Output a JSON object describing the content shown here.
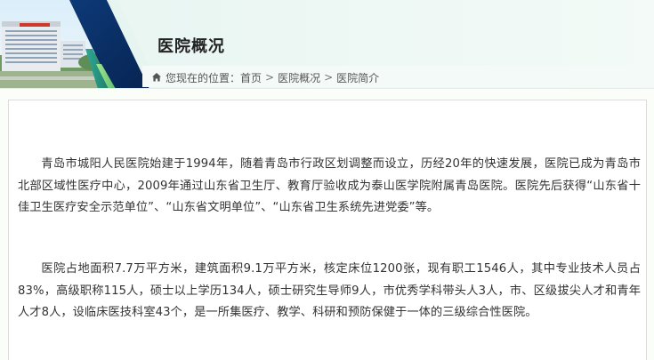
{
  "header": {
    "title": "医院概况"
  },
  "breadcrumb": {
    "prefix": "您现在的位置：",
    "items": [
      "首页",
      "医院概况",
      "医院简介"
    ],
    "separator": ">"
  },
  "icons": {
    "home": "home-icon"
  },
  "colors": {
    "header_bg": "#e2f3f0",
    "accent_dark": "#0b2b63",
    "accent_teal": "#2b8f7c",
    "accent_green": "#7fd17b",
    "text": "#333333"
  },
  "content": {
    "paragraphs": [
      "青岛市城阳人民医院始建于1994年，随着青岛市行政区划调整而设立，历经20年的快速发展，医院已成为青岛市北部区域性医疗中心，2009年通过山东省卫生厅、教育厅验收成为泰山医学院附属青岛医院。医院先后获得“山东省十佳卫生医疗安全示范单位”、“山东省文明单位”、“山东省卫生系统先进党委”等。",
      "医院占地面积7.7万平方米，建筑面积9.1万平方米，核定床位1200张，现有职工1546人，其中专业技术人员占83%，高级职称115人，硕士以上学历134人，硕士研究生导师9人，市优秀学科带头人3人，市、区级拔尖人才和青年人才8人，设临床医技科室43个，是一所集医疗、教学、科研和预防保健于一体的三级综合性医院。"
    ]
  }
}
